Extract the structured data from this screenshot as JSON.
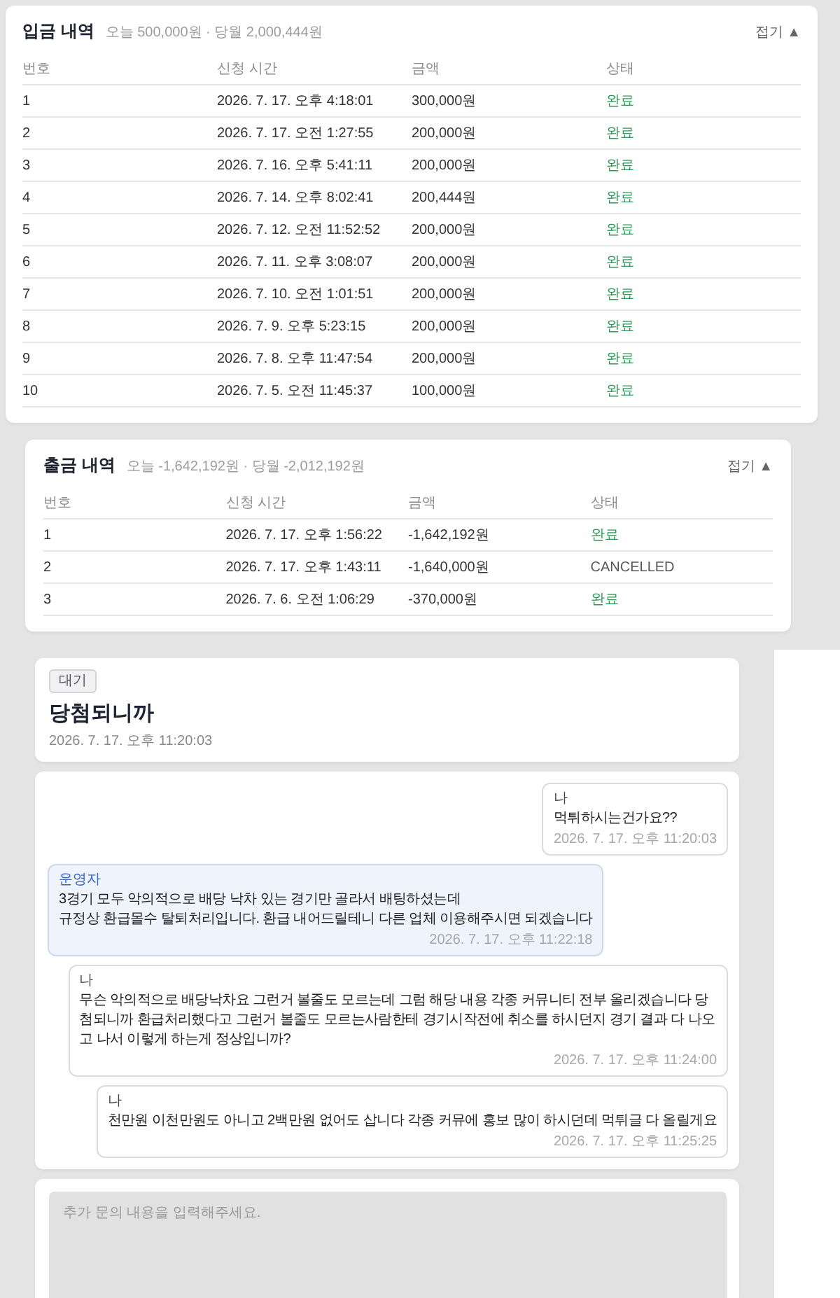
{
  "deposits": {
    "title": "입금 내역",
    "summary": "오늘 500,000원 · 당월 2,000,444원",
    "collapse": "접기 ▲",
    "columns": [
      "번호",
      "신청 시간",
      "금액",
      "상태"
    ],
    "rows": [
      {
        "no": "1",
        "time": "2026. 7. 17. 오후 4:18:01",
        "amount": "300,000원",
        "status": "완료",
        "completed": true
      },
      {
        "no": "2",
        "time": "2026. 7. 17. 오전 1:27:55",
        "amount": "200,000원",
        "status": "완료",
        "completed": true
      },
      {
        "no": "3",
        "time": "2026. 7. 16. 오후 5:41:11",
        "amount": "200,000원",
        "status": "완료",
        "completed": true
      },
      {
        "no": "4",
        "time": "2026. 7. 14. 오후 8:02:41",
        "amount": "200,444원",
        "status": "완료",
        "completed": true
      },
      {
        "no": "5",
        "time": "2026. 7. 12. 오전 11:52:52",
        "amount": "200,000원",
        "status": "완료",
        "completed": true
      },
      {
        "no": "6",
        "time": "2026. 7. 11. 오후 3:08:07",
        "amount": "200,000원",
        "status": "완료",
        "completed": true
      },
      {
        "no": "7",
        "time": "2026. 7. 10. 오전 1:01:51",
        "amount": "200,000원",
        "status": "완료",
        "completed": true
      },
      {
        "no": "8",
        "time": "2026. 7. 9. 오후 5:23:15",
        "amount": "200,000원",
        "status": "완료",
        "completed": true
      },
      {
        "no": "9",
        "time": "2026. 7. 8. 오후 11:47:54",
        "amount": "200,000원",
        "status": "완료",
        "completed": true
      },
      {
        "no": "10",
        "time": "2026. 7. 5. 오전 11:45:37",
        "amount": "100,000원",
        "status": "완료",
        "completed": true
      }
    ]
  },
  "withdrawals": {
    "title": "출금 내역",
    "summary": "오늘 -1,642,192원 · 당월 -2,012,192원",
    "collapse": "접기 ▲",
    "columns": [
      "번호",
      "신청 시간",
      "금액",
      "상태"
    ],
    "rows": [
      {
        "no": "1",
        "time": "2026. 7. 17. 오후 1:56:22",
        "amount": "-1,642,192원",
        "status": "완료",
        "completed": true
      },
      {
        "no": "2",
        "time": "2026. 7. 17. 오후 1:43:11",
        "amount": "-1,640,000원",
        "status": "CANCELLED",
        "completed": false
      },
      {
        "no": "3",
        "time": "2026. 7. 6. 오전 1:06:29",
        "amount": "-370,000원",
        "status": "완료",
        "completed": true
      }
    ]
  },
  "inquiry": {
    "badge": "대기",
    "title": "당첨되니까",
    "date": "2026. 7. 17. 오후 11:20:03"
  },
  "messages": [
    {
      "kind": "user",
      "sender": "나",
      "text": "먹튀하시는건가요??",
      "time": "2026. 7. 17. 오후 11:20:03"
    },
    {
      "kind": "admin",
      "sender": "운영자",
      "text": "3경기 모두 악의적으로 배당 낙차 있는 경기만 골라서 배팅하셨는데\n규정상 환급몰수 탈퇴처리입니다. 환급 내어드릴테니 다른 업체 이용해주시면 되겠습니다",
      "time": "2026. 7. 17. 오후 11:22:18"
    },
    {
      "kind": "user",
      "sender": "나",
      "text": "무슨 악의적으로 배당낙차요 그런거 볼줄도 모르는데 그럼 해당 내용 각종 커뮤니티 전부 올리겠습니다 당첨되니까 환급처리했다고 그런거 볼줄도 모르는사람한테 경기시작전에 취소를 하시던지 경기 결과 다 나오고 나서 이렇게 하는게 정상입니까?",
      "time": "2026. 7. 17. 오후 11:24:00"
    },
    {
      "kind": "user",
      "sender": "나",
      "text": "천만원 이천만원도 아니고 2백만원 없어도 삽니다 각종 커뮤에 홍보 많이 하시던데 먹튀글 다 올릴게요",
      "time": "2026. 7. 17. 오후 11:25:25"
    }
  ],
  "reply": {
    "placeholder": "추가 문의 내용을 입력해주세요."
  }
}
